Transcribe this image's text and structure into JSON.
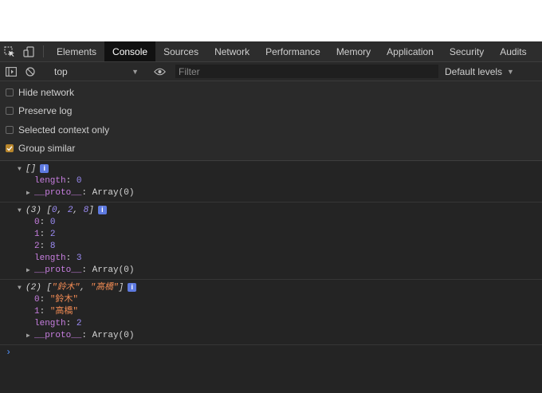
{
  "tabs": [
    "Elements",
    "Console",
    "Sources",
    "Network",
    "Performance",
    "Memory",
    "Application",
    "Security",
    "Audits"
  ],
  "toolbar": {
    "context": "top",
    "filter_placeholder": "Filter",
    "levels": "Default levels"
  },
  "settings": [
    {
      "label": "Hide network",
      "checked": false
    },
    {
      "label": "Preserve log",
      "checked": false
    },
    {
      "label": "Selected context only",
      "checked": false
    },
    {
      "label": "Group similar",
      "checked": true
    }
  ],
  "messages": {
    "m1": {
      "header": "[]",
      "length_key": "length",
      "length_val": "0",
      "proto_key": "__proto__",
      "proto_val": "Array(0)"
    },
    "m2": {
      "count": "(3)",
      "items": [
        "0",
        "2",
        "8"
      ],
      "props": [
        {
          "key": "0",
          "val": "0"
        },
        {
          "key": "1",
          "val": "2"
        },
        {
          "key": "2",
          "val": "8"
        }
      ],
      "length_key": "length",
      "length_val": "3",
      "proto_key": "__proto__",
      "proto_val": "Array(0)"
    },
    "m3": {
      "count": "(2)",
      "items": [
        "\"鈴木\"",
        "\"高橋\""
      ],
      "props": [
        {
          "key": "0",
          "val": "\"鈴木\""
        },
        {
          "key": "1",
          "val": "\"高橋\""
        }
      ],
      "length_key": "length",
      "length_val": "2",
      "proto_key": "__proto__",
      "proto_val": "Array(0)"
    }
  },
  "prompt_symbol": "›",
  "colors": {
    "panel_bg": "#242424",
    "active_tab_bg": "#111111",
    "number": "#9c8cf6",
    "property_key": "#c77ee0",
    "string": "#f28b54",
    "checkbox_checked": "#b8862c",
    "info_badge": "#5e7ae0"
  }
}
